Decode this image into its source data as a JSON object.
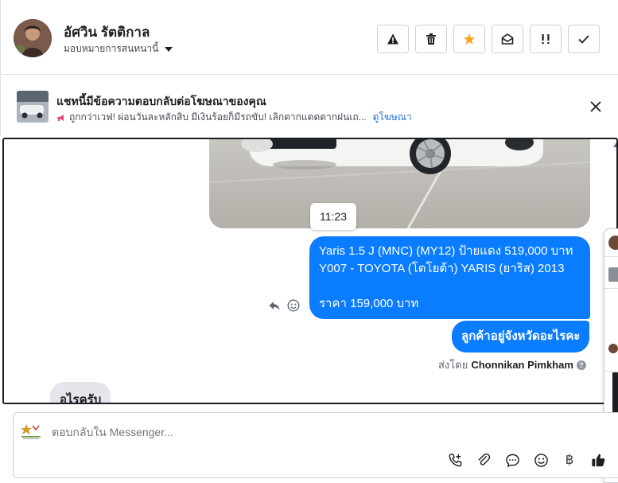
{
  "header": {
    "contact_name": "อัศวิน รัตติกาล",
    "assign_label": "มอบหมายการสนทนานี้",
    "actions": [
      {
        "icon": "warning-icon"
      },
      {
        "icon": "trash-icon"
      },
      {
        "icon": "star-icon",
        "color": "#f5a623"
      },
      {
        "icon": "mark-unread-icon"
      },
      {
        "icon": "follow-up-icon"
      },
      {
        "icon": "done-check-icon"
      }
    ]
  },
  "ad_banner": {
    "title": "แชทนี้มีข้อความตอบกลับต่อโฆษณาของคุณ",
    "subtitle": "ถูกกว่าเวฟ! ผ่อนวันละหลักสิบ มีเงินร้อยก็มีรถขับ! เลิกตากแดดตากฝนเถ...",
    "link_label": "ดูโฆษณา"
  },
  "chat": {
    "timestamp": "11:23",
    "outgoing_message_lines": [
      "Yaris 1.5 J (MNC) (MY12) ป้ายแดง 519,000 บาท",
      "Y007 - TOYOTA (โตโยต้า) YARIS (ยาริส) 2013",
      "",
      "ราคา 159,000 บาท"
    ],
    "outgoing_question": "ลูกค้าอยู่จังหวัดอะไรคะ",
    "sent_by_prefix": "ส่งโดย",
    "sent_by_name": "Chonnikan Pimkham",
    "help_glyph": "?",
    "incoming_message": "อุไรครับ"
  },
  "composer": {
    "placeholder": "ตอบกลับใน Messenger...",
    "currency_glyph": "฿"
  },
  "colors": {
    "accent_blue": "#0a7cff",
    "link_blue": "#216fdb",
    "star_orange": "#f5a623"
  }
}
